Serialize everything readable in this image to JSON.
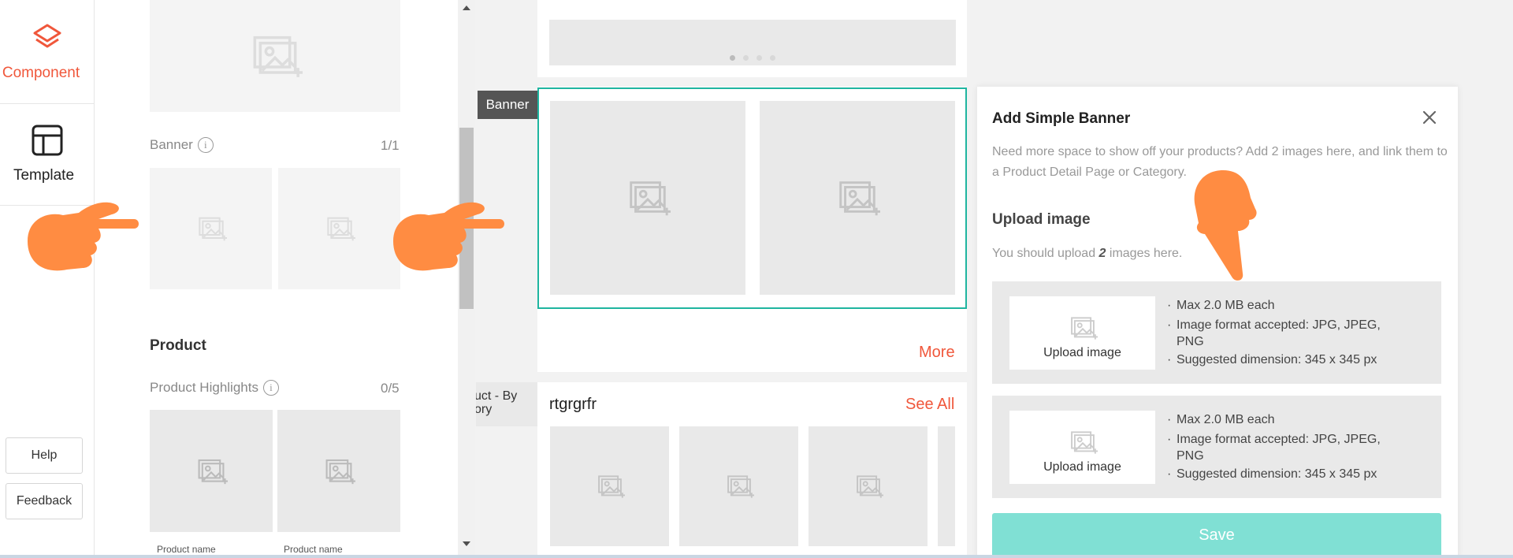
{
  "nav": {
    "component_label": "Component",
    "template_label": "Template",
    "help_label": "Help",
    "feedback_label": "Feedback"
  },
  "panel": {
    "banner_label": "Banner",
    "banner_count": "1/1",
    "product_section": "Product",
    "product_highlights_label": "Product Highlights",
    "product_highlights_count": "0/5",
    "product_name_1": "Product name",
    "product_name_2": "Product name"
  },
  "canvas": {
    "banner_tag": "Banner",
    "product_tag": "uct - By\nory",
    "more_label": "More",
    "section_title": "rtgrgrfr",
    "see_all_label": "See All"
  },
  "dialog": {
    "title": "Add Simple Banner",
    "description_part1": "Need more space to show off your products? Add 2 images here, and link them to a Product Detail Page or ",
    "description_part2": "Category.",
    "upload_heading": "Upload image",
    "hint_prefix": "You should upload ",
    "hint_count": "2",
    "hint_suffix": " images here.",
    "slots": [
      {
        "button_label": "Upload image",
        "specs": [
          "Max 2.0 MB each",
          "Image format accepted: JPG, JPEG, PNG",
          "Suggested dimension: 345 x 345 px"
        ]
      },
      {
        "button_label": "Upload image",
        "specs": [
          "Max 2.0 MB each",
          "Image format accepted: JPG, JPEG, PNG",
          "Suggested dimension: 345 x 345 px"
        ]
      }
    ],
    "save_label": "Save"
  },
  "colors": {
    "accent": "#f0573b",
    "teal_border": "#1fb5a0",
    "save_button": "#80e0d4",
    "hand_pointer": "#ff8c42"
  },
  "icons": [
    "layers-icon",
    "template-icon",
    "image-placeholder-icon",
    "info-icon",
    "close-icon",
    "hand-pointer-icon",
    "scroll-up-arrow-icon",
    "scroll-down-arrow-icon"
  ]
}
